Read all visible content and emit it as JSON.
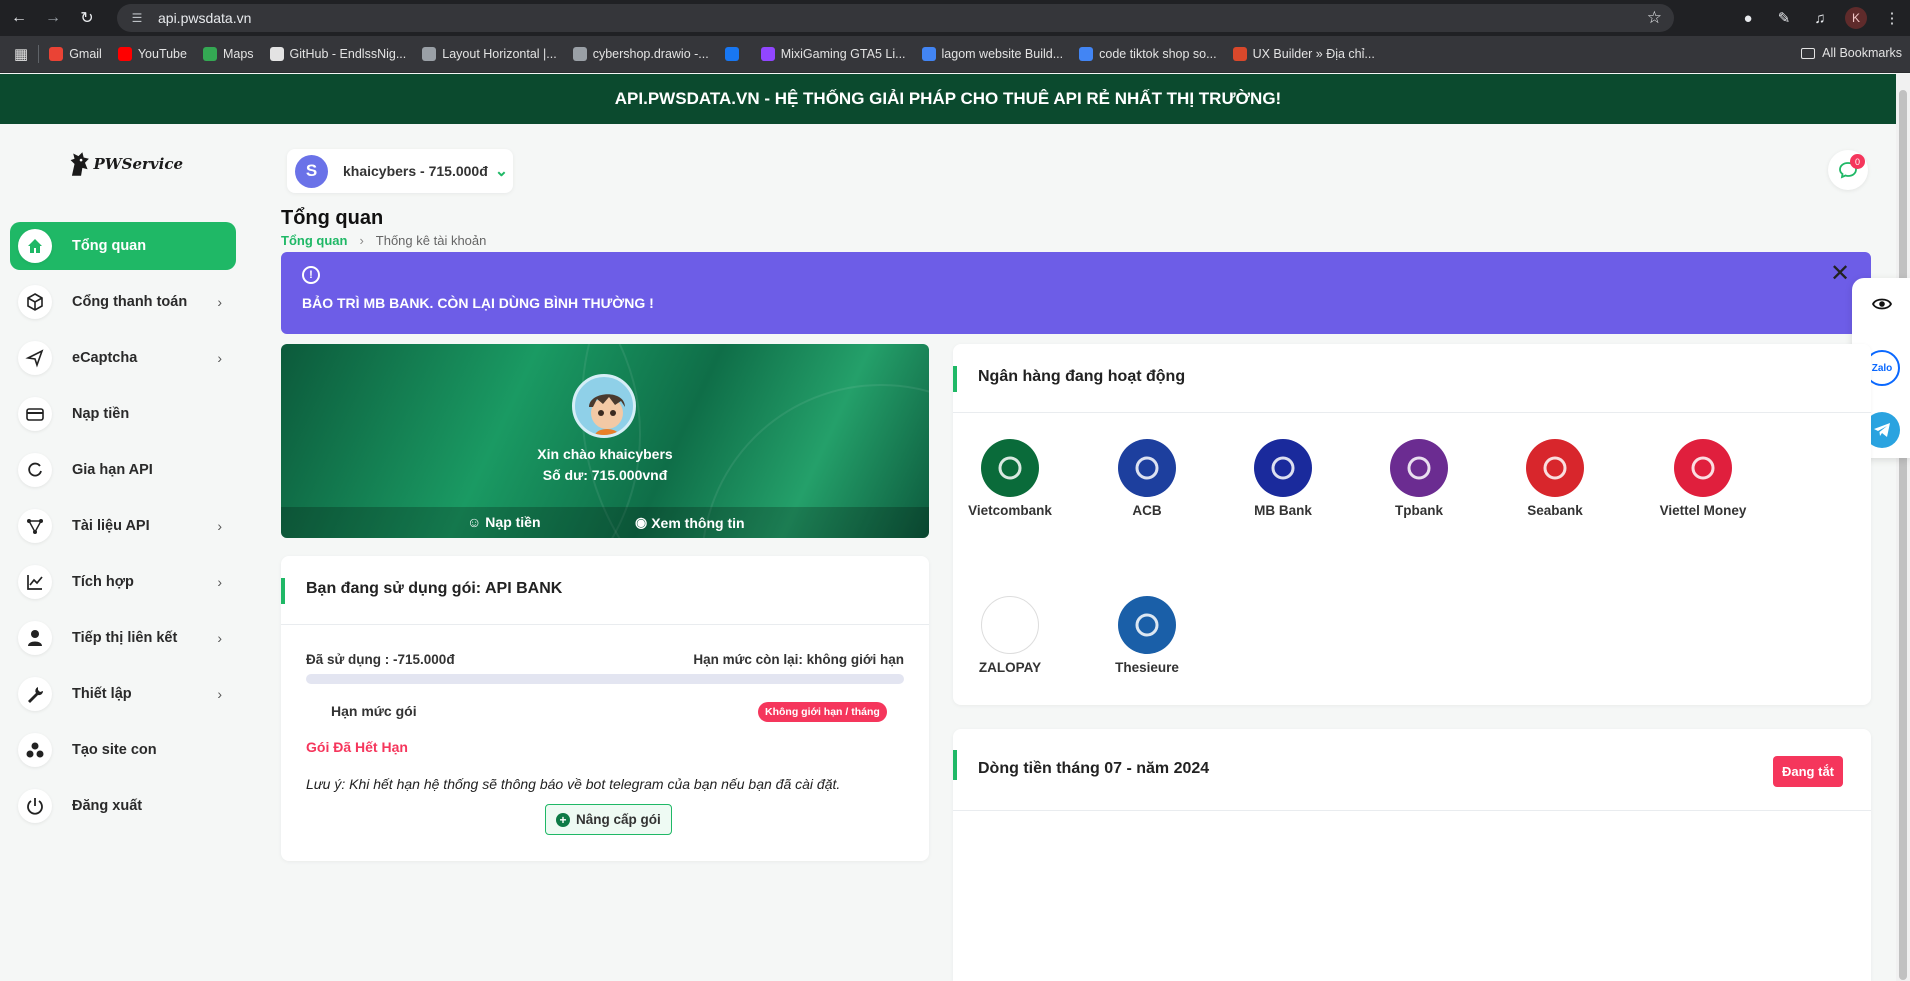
{
  "browser": {
    "url": "api.pwsdata.vn",
    "profile_initial": "K",
    "bookmarks": [
      {
        "label": "Gmail",
        "color": "#ea4335"
      },
      {
        "label": "YouTube",
        "color": "#ff0000"
      },
      {
        "label": "Maps",
        "color": "#34a853"
      },
      {
        "label": "GitHub - EndlssNig...",
        "color": "#e3e3e3"
      },
      {
        "label": "Layout Horizontal |...",
        "color": "#9aa0a6"
      },
      {
        "label": "cybershop.drawio -...",
        "color": "#9aa0a6"
      },
      {
        "label": "",
        "color": "#1877f2"
      },
      {
        "label": "MixiGaming GTA5 Li...",
        "color": "#9146ff"
      },
      {
        "label": "lagom website Build...",
        "color": "#4285f4"
      },
      {
        "label": "code tiktok shop so...",
        "color": "#4285f4"
      },
      {
        "label": "UX Builder » Địa chỉ...",
        "color": "#d9482b"
      }
    ],
    "all_bookmarks": "All Bookmarks"
  },
  "announcement": "API.PWSDATA.VN - HỆ THỐNG GIẢI PHÁP CHO THUÊ API RẺ NHẤT THỊ TRƯỜNG!",
  "logo": {
    "text": "PWService"
  },
  "sidebar": {
    "items": [
      {
        "label": "Tổng quan",
        "icon": "home-icon",
        "active": true,
        "has_children": false
      },
      {
        "label": "Cổng thanh toán",
        "icon": "box-icon",
        "active": false,
        "has_children": true
      },
      {
        "label": "eCaptcha",
        "icon": "send-icon",
        "active": false,
        "has_children": true
      },
      {
        "label": "Nạp tiền",
        "icon": "card-icon",
        "active": false,
        "has_children": false
      },
      {
        "label": "Gia hạn API",
        "icon": "refresh-icon",
        "active": false,
        "has_children": false
      },
      {
        "label": "Tài liệu API",
        "icon": "nodes-icon",
        "active": false,
        "has_children": true
      },
      {
        "label": "Tích hợp",
        "icon": "chart-icon",
        "active": false,
        "has_children": true
      },
      {
        "label": "Tiếp thị liên kết",
        "icon": "user-icon",
        "active": false,
        "has_children": true
      },
      {
        "label": "Thiết lập",
        "icon": "wrench-icon",
        "active": false,
        "has_children": true
      },
      {
        "label": "Tạo site con",
        "icon": "cluster-icon",
        "active": false,
        "has_children": false
      },
      {
        "label": "Đăng xuất",
        "icon": "power-icon",
        "active": false,
        "has_children": false
      }
    ]
  },
  "user": {
    "avatar_letter": "S",
    "label": "khaicybers - 715.000đ"
  },
  "chat": {
    "badge": "0"
  },
  "page": {
    "title": "Tổng quan",
    "breadcrumb_home": "Tổng quan",
    "breadcrumb_current": "Thống kê tài khoản"
  },
  "alert": {
    "text": "BẢO TRÌ MB BANK. CÒN LẠI DÙNG BÌNH THƯỜNG !",
    "icon": "info-icon"
  },
  "hero": {
    "greeting": "Xin chào khaicybers",
    "balance": "Số dư: 715.000vnđ",
    "topup_label": "Nạp tiền",
    "info_label": "Xem thông tin"
  },
  "package": {
    "title": "Bạn đang sử dụng gói: API BANK",
    "used": "Đã sử dụng : -715.000đ",
    "remaining": "Hạn mức còn lại: không giới hạn",
    "progress_percent": 0,
    "quota_label": "Hạn mức gói",
    "quota_badge": "Không giới hạn / tháng",
    "expired": "Gói Đã Hết Hạn",
    "note": "Lưu ý: Khi hết hạn hệ thống sẽ thông báo về bot telegram của bạn nếu bạn đã cài đặt.",
    "upgrade_label": "Nâng cấp gói"
  },
  "banks": {
    "title": "Ngân hàng đang hoạt động",
    "list": [
      {
        "name": "Vietcombank",
        "color": "#0a6b3a"
      },
      {
        "name": "ACB",
        "color": "#1d3f9e"
      },
      {
        "name": "MB Bank",
        "color": "#1a2a9c"
      },
      {
        "name": "Tpbank",
        "color": "#6b2c91"
      },
      {
        "name": "Seabank",
        "color": "#d8262c"
      },
      {
        "name": "Viettel Money",
        "color": "#e01f3d"
      },
      {
        "name": "ZALOPAY",
        "color": "#ffffff"
      },
      {
        "name": "Thesieure",
        "color": "#1a5fa8"
      }
    ]
  },
  "cashflow": {
    "title": "Dòng tiền tháng 07 - năm 2024",
    "toggle_label": "Đang tắt"
  },
  "floating": {
    "zalo_label": "Zalo"
  }
}
